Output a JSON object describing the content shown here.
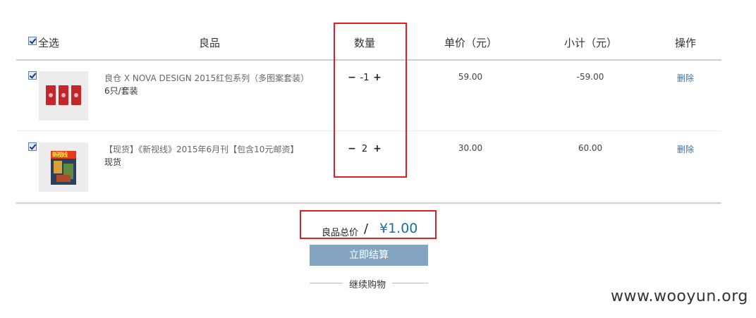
{
  "header": {
    "select_all": "全选",
    "product": "良品",
    "quantity": "数量",
    "unit_price": "单价（元）",
    "subtotal": "小计（元）",
    "action": "操作"
  },
  "items": [
    {
      "checked": true,
      "name": "良仓 X NOVA DESIGN 2015红包系列（多图案套装）",
      "spec": "6只/套装",
      "quantity": "-1",
      "unit_price": "59.00",
      "subtotal": "-59.00",
      "delete": "删除"
    },
    {
      "checked": true,
      "name": "【现货】《新视线》2015年6月刊【包含10元邮资】",
      "spec": "现货",
      "quantity": "2",
      "unit_price": "30.00",
      "subtotal": "60.00",
      "delete": "删除",
      "thumb_text": "新视线"
    }
  ],
  "qty_controls": {
    "minus": "−",
    "plus": "+"
  },
  "total": {
    "label": "良品总价",
    "slash": "/",
    "value": "¥1.00"
  },
  "checkout_label": "立即结算",
  "continue_label": "继续购物",
  "watermark": "www.wooyun.org",
  "colors": {
    "accent_link": "#3a6e9f",
    "total_price": "#1a6fa8",
    "checkout_bg": "#84a5c2",
    "highlight_box": "#e02020"
  }
}
